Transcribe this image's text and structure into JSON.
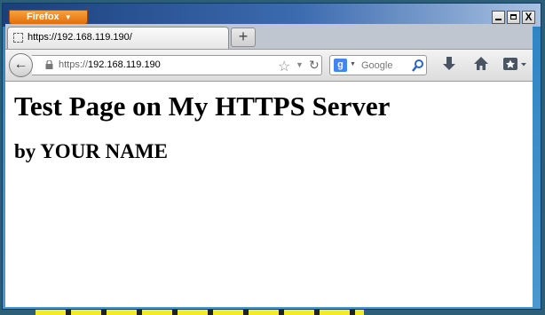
{
  "app": {
    "menu_button_label": "Firefox"
  },
  "window_controls": {
    "close_symbol": "X"
  },
  "tabs": [
    {
      "title": "https://192.168.119.190/"
    }
  ],
  "newtab": {
    "symbol": "+"
  },
  "urlbar": {
    "scheme": "https://",
    "host": "192.168.119.190"
  },
  "search": {
    "engine_letter": "g",
    "placeholder": "Google"
  },
  "page": {
    "heading": "Test Page on My HTTPS Server",
    "subheading": "by YOUR NAME"
  },
  "icons": [
    "back-icon",
    "lock-icon",
    "star-icon",
    "history-dropdown-icon",
    "reload-icon",
    "google-icon",
    "search-icon",
    "download-icon",
    "home-icon",
    "bookmarks-icon"
  ],
  "colors": {
    "firefox_button": "#e46d0c",
    "titlebar": "#1a3f7a",
    "content_bg": "#ffffff"
  }
}
